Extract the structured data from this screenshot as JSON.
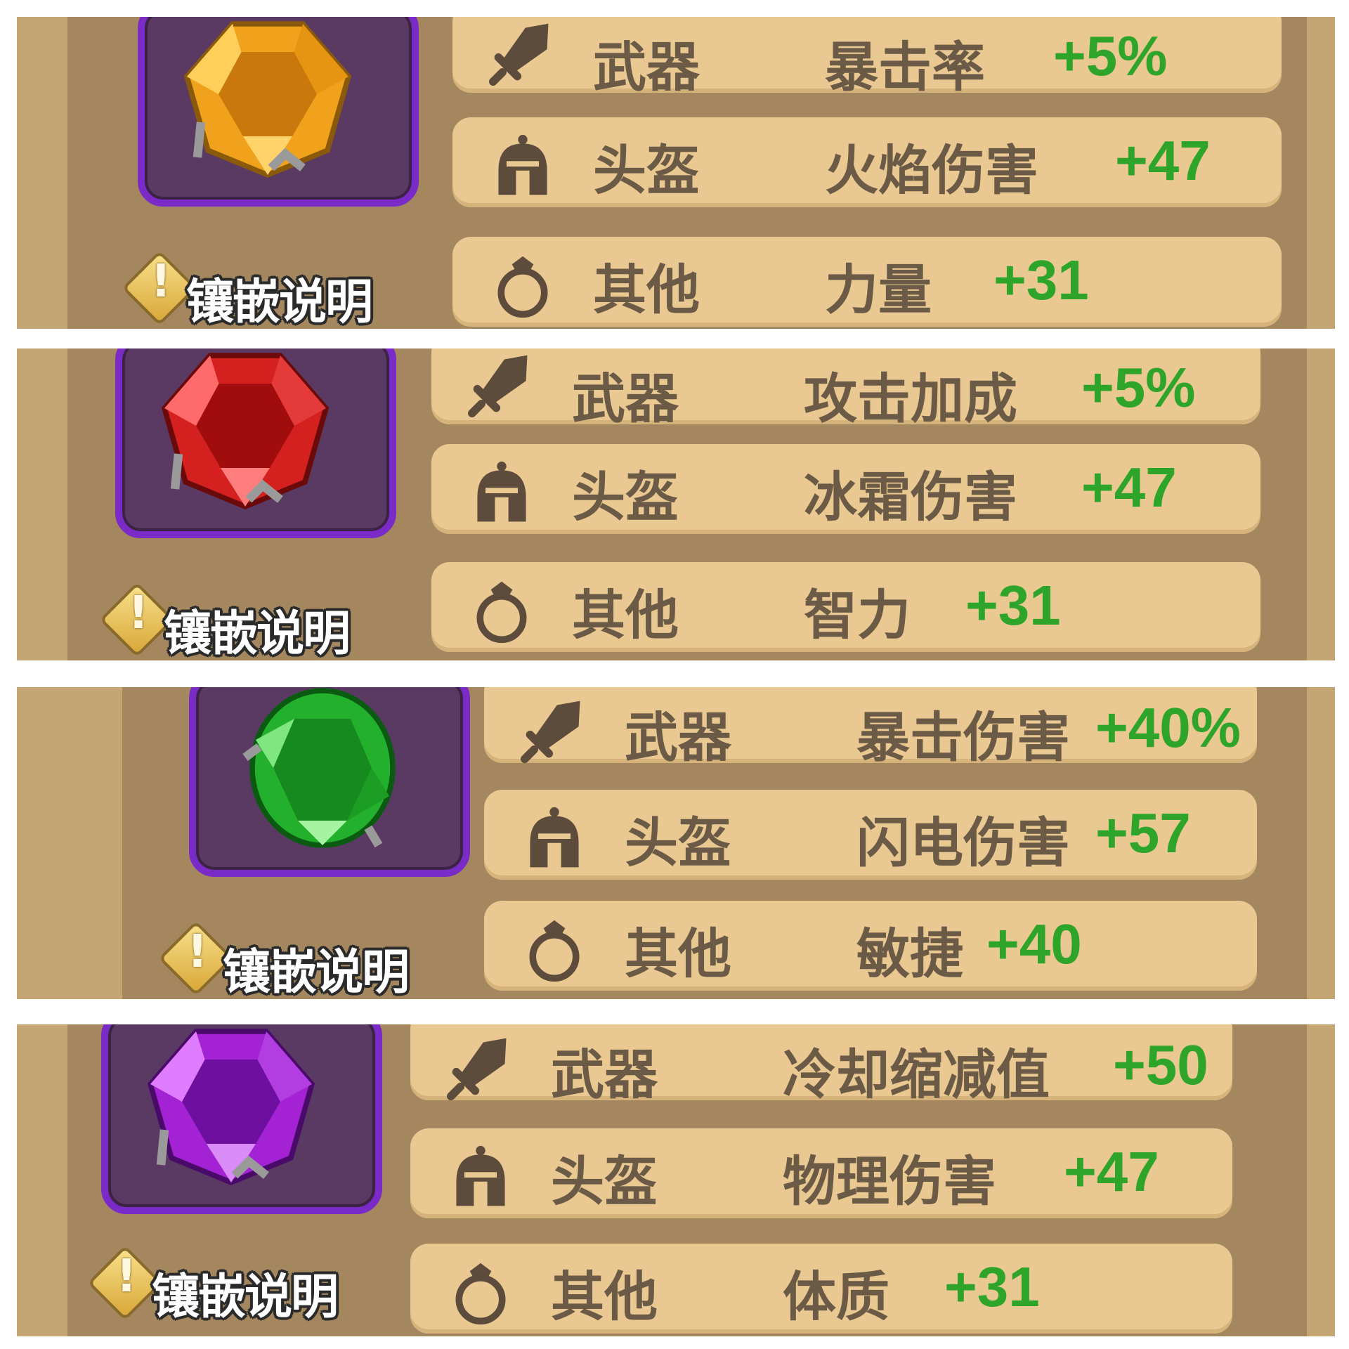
{
  "badge_label": "镶嵌说明",
  "colors": {
    "value_green": "#2ea52a",
    "text_brown": "#6b5a46",
    "row_bg": "#e9c891",
    "frame_purple": "#7a2bc7"
  },
  "panels": [
    {
      "gem": "topaz-gem-icon",
      "gem_color": "#f0a21c",
      "rows": [
        {
          "icon": "sword-icon",
          "slot": "武器",
          "stat": "暴击率",
          "value": "+5%"
        },
        {
          "icon": "helmet-icon",
          "slot": "头盔",
          "stat": "火焰伤害",
          "value": "+47"
        },
        {
          "icon": "ring-icon",
          "slot": "其他",
          "stat": "力量",
          "value": "+31"
        }
      ]
    },
    {
      "gem": "ruby-gem-icon",
      "gem_color": "#d4201f",
      "rows": [
        {
          "icon": "sword-icon",
          "slot": "武器",
          "stat": "攻击加成",
          "value": "+5%"
        },
        {
          "icon": "helmet-icon",
          "slot": "头盔",
          "stat": "冰霜伤害",
          "value": "+47"
        },
        {
          "icon": "ring-icon",
          "slot": "其他",
          "stat": "智力",
          "value": "+31"
        }
      ]
    },
    {
      "gem": "emerald-gem-icon",
      "gem_color": "#23b02c",
      "rows": [
        {
          "icon": "sword-icon",
          "slot": "武器",
          "stat": "暴击伤害",
          "value": "+40%"
        },
        {
          "icon": "helmet-icon",
          "slot": "头盔",
          "stat": "闪电伤害",
          "value": "+57"
        },
        {
          "icon": "ring-icon",
          "slot": "其他",
          "stat": "敏捷",
          "value": "+40"
        }
      ]
    },
    {
      "gem": "amethyst-gem-icon",
      "gem_color": "#a323d4",
      "rows": [
        {
          "icon": "sword-icon",
          "slot": "武器",
          "stat": "冷却缩减值",
          "value": "+50"
        },
        {
          "icon": "helmet-icon",
          "slot": "头盔",
          "stat": "物理伤害",
          "value": "+47"
        },
        {
          "icon": "ring-icon",
          "slot": "其他",
          "stat": "体质",
          "value": "+31"
        }
      ]
    }
  ]
}
